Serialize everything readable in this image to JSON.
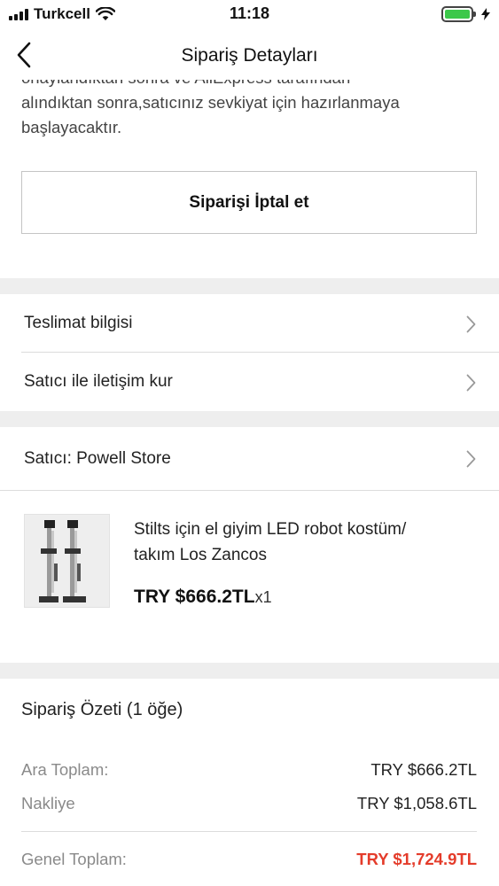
{
  "status_bar": {
    "carrier": "Turkcell",
    "time": "11:18",
    "battery_color": "#3cc84a"
  },
  "nav": {
    "title": "Sipariş Detayları",
    "back_icon": "chevron-left-icon"
  },
  "notice": {
    "line1": "onaylandıktan sonra ve AliExpress tarafından",
    "line2": "alındıktan sonra,satıcınız sevkiyat için hazırlanmaya",
    "line3": "başlayacaktır."
  },
  "cancel_button": {
    "label": "Siparişi İptal et"
  },
  "links": {
    "delivery_info": "Teslimat bilgisi",
    "contact_seller": "Satıcı ile iletişim kur"
  },
  "seller": {
    "label": "Satıcı: Powell Store"
  },
  "product": {
    "title_line1": "Stilts için el giyim LED robot kostüm/",
    "title_line2": "takım Los Zancos",
    "price": "TRY $666.2TL",
    "quantity": "x1"
  },
  "summary": {
    "title": "Sipariş Özeti (1 öğe)",
    "subtotal_label": "Ara Toplam:",
    "subtotal_value": "TRY $666.2TL",
    "shipping_label": "Nakliye",
    "shipping_value": "TRY $1,058.6TL",
    "total_label": "Genel Toplam:",
    "total_value": "TRY $1,724.9TL",
    "total_color": "#e43c2b"
  }
}
